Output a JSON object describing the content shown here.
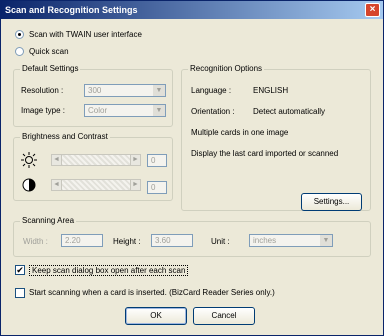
{
  "title": "Scan and Recognition Settings",
  "close": "×",
  "scan_modes": {
    "twain": "Scan with TWAIN user interface",
    "quick": "Quick scan",
    "selected": "twain"
  },
  "default_settings": {
    "legend": "Default Settings",
    "resolution_label": "Resolution :",
    "resolution_value": "300",
    "image_type_label": "Image type :",
    "image_type_value": "Color"
  },
  "brightness_contrast": {
    "legend": "Brightness and Contrast",
    "brightness_value": "0",
    "contrast_value": "0",
    "left_arrow": "◄",
    "right_arrow": "►"
  },
  "recognition_options": {
    "legend": "Recognition Options",
    "language_label": "Language :",
    "language_value": "ENGLISH",
    "orientation_label": "Orientation :",
    "orientation_value": "Detect automatically",
    "multiple_cards": "Multiple cards in one image",
    "display_last": "Display the last card imported or scanned",
    "settings_button": "Settings..."
  },
  "scanning_area": {
    "legend": "Scanning Area",
    "width_label": "Width :",
    "width_value": "2.20",
    "height_label": "Height :",
    "height_value": "3.60",
    "unit_label": "Unit :",
    "unit_value": "inches"
  },
  "options": {
    "keep_open": "Keep scan dialog box open after each scan",
    "keep_open_checked": true,
    "start_on_insert": "Start scanning when a card is inserted. (BizCard Reader Series only.)",
    "start_on_insert_checked": false
  },
  "buttons": {
    "ok": "OK",
    "cancel": "Cancel"
  },
  "combo_arrow": "▼",
  "check_mark": "✔"
}
